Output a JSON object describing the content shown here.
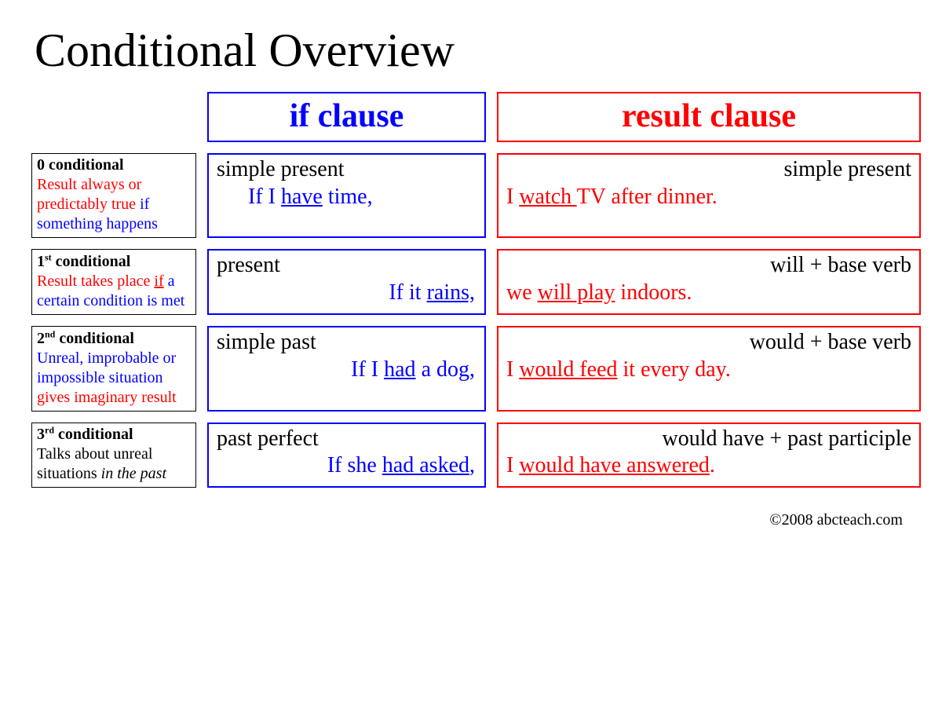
{
  "title": "Conditional Overview",
  "headers": {
    "if": "if clause",
    "result": "result clause"
  },
  "rows": [
    {
      "label_name_html": "0 conditional",
      "label_desc_html": "<span class='red'>Result always or predictably true</span> <span class='blue'>if something happens</span>",
      "if_tense": "simple present",
      "if_example_html": "If I <span class='under'>have</span> time,",
      "result_tense": "simple present",
      "result_example_html": "I <span class='under'>watch </span>TV after dinner."
    },
    {
      "label_name_html": "1<sup>st</sup> conditional",
      "label_desc_html": "<span class='red'>Result takes place <span class='under'>if</span></span> <span class='blue'>a certain condition is met</span>",
      "if_tense": "present",
      "if_example_html": "If it <span class='under'>rains,</span>",
      "result_tense": "will + base verb",
      "result_example_html": "we <span class='under'>will play</span> indoors."
    },
    {
      "label_name_html": "2<sup>nd</sup> conditional",
      "label_desc_html": "<span class='blue'>Unreal, improbable or impossible situation</span> <span class='red'>gives imaginary result</span>",
      "if_tense": "simple past",
      "if_example_html": "If I <span class='under'>had</span> a dog,",
      "result_tense": "would + base verb",
      "result_example_html": "I <span class='under'>would feed</span> it every day."
    },
    {
      "label_name_html": "3<sup>rd</sup> conditional",
      "label_desc_html": "<span class='blk'>Talks about unreal situations <span class='ital'>in the past</span></span>",
      "if_tense": "past perfect",
      "if_example_html": "If she <span class='under'>had asked</span>,",
      "result_tense": "would have + past participle",
      "result_example_html": "I <span class='under'>would have answered</span>."
    }
  ],
  "copyright": "©2008 abcteach.com"
}
